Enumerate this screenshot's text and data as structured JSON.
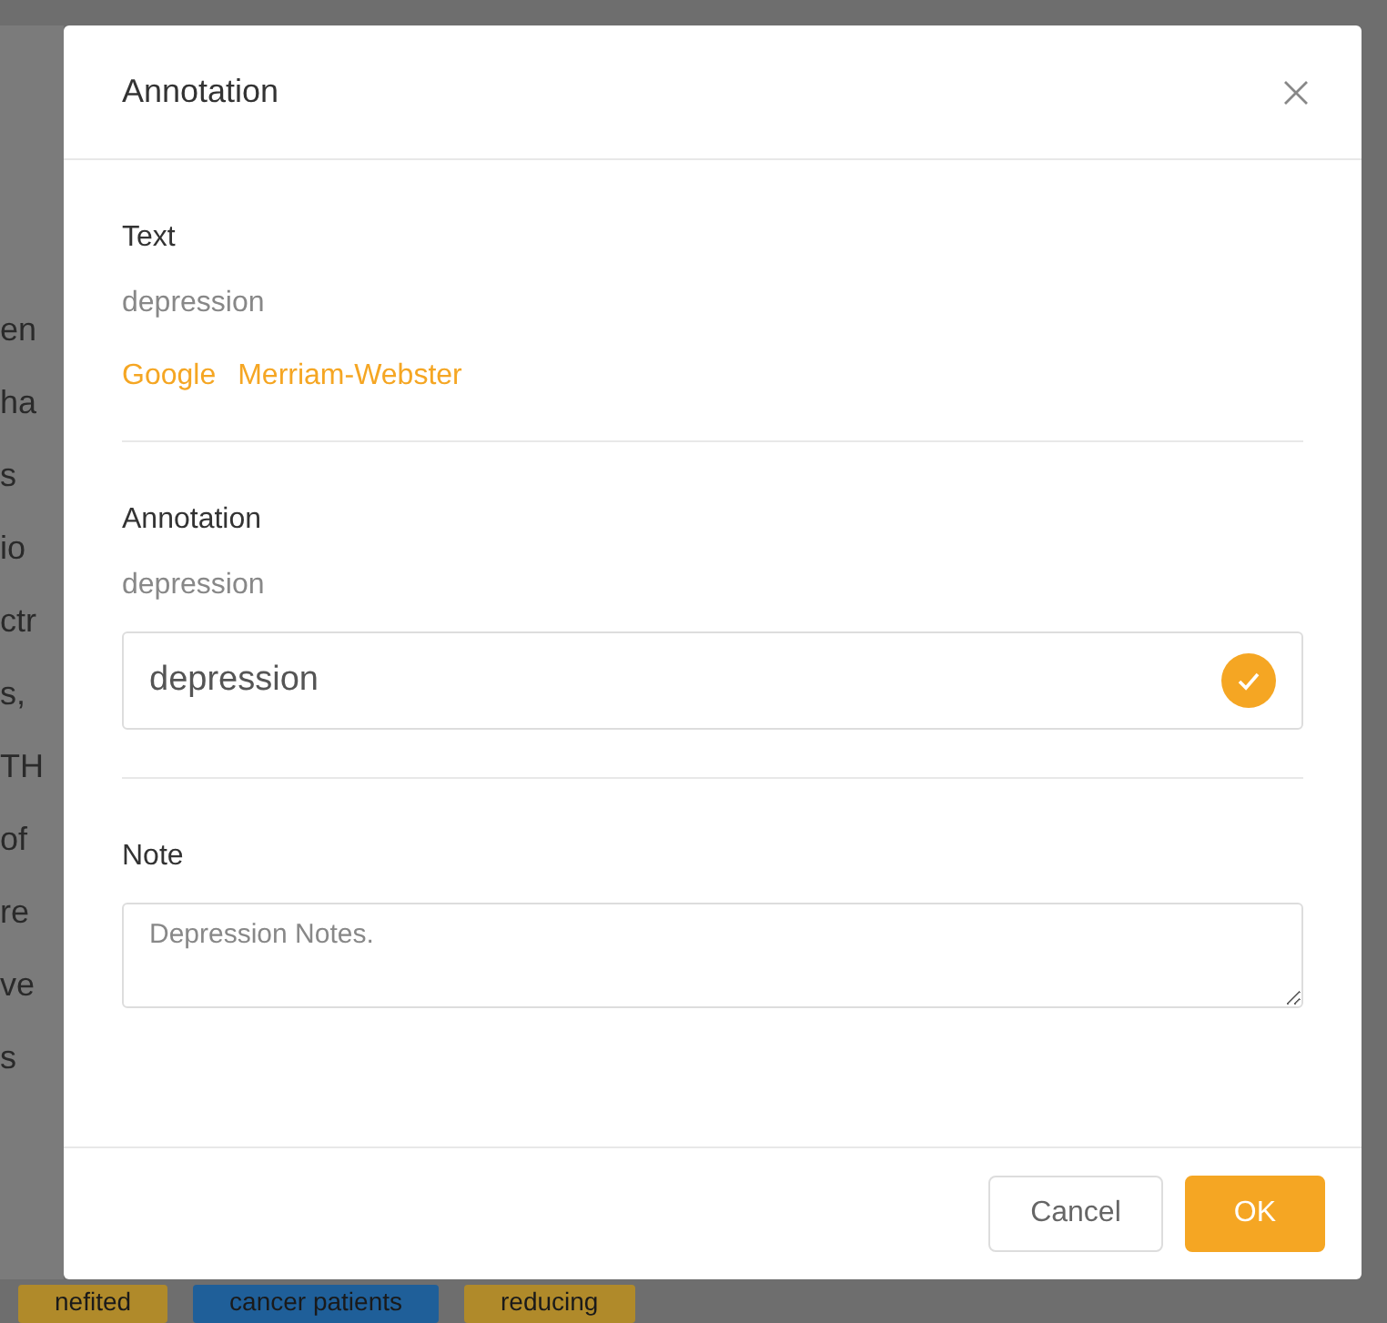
{
  "background": {
    "fragments": [
      "en",
      "ha",
      "s",
      "io",
      "ctr",
      "s,",
      "TH",
      "of",
      "re",
      "ve",
      "s"
    ],
    "tags": [
      {
        "label": "nefited",
        "color": "#b08a2a"
      },
      {
        "label": "cancer patients",
        "color": "#1f5f99"
      },
      {
        "label": "reducing",
        "color": "#b08a2a"
      }
    ]
  },
  "dialog": {
    "title": "Annotation",
    "text_section": {
      "label": "Text",
      "value": "depression",
      "links": [
        "Google",
        "Merriam-Webster"
      ]
    },
    "annotation_section": {
      "label": "Annotation",
      "value": "depression",
      "input": "depression",
      "valid": true
    },
    "note_section": {
      "label": "Note",
      "value": "Depression Notes."
    },
    "buttons": [
      {
        "label": "Cancel",
        "kind": "secondary"
      },
      {
        "label": "OK",
        "kind": "primary"
      }
    ]
  }
}
